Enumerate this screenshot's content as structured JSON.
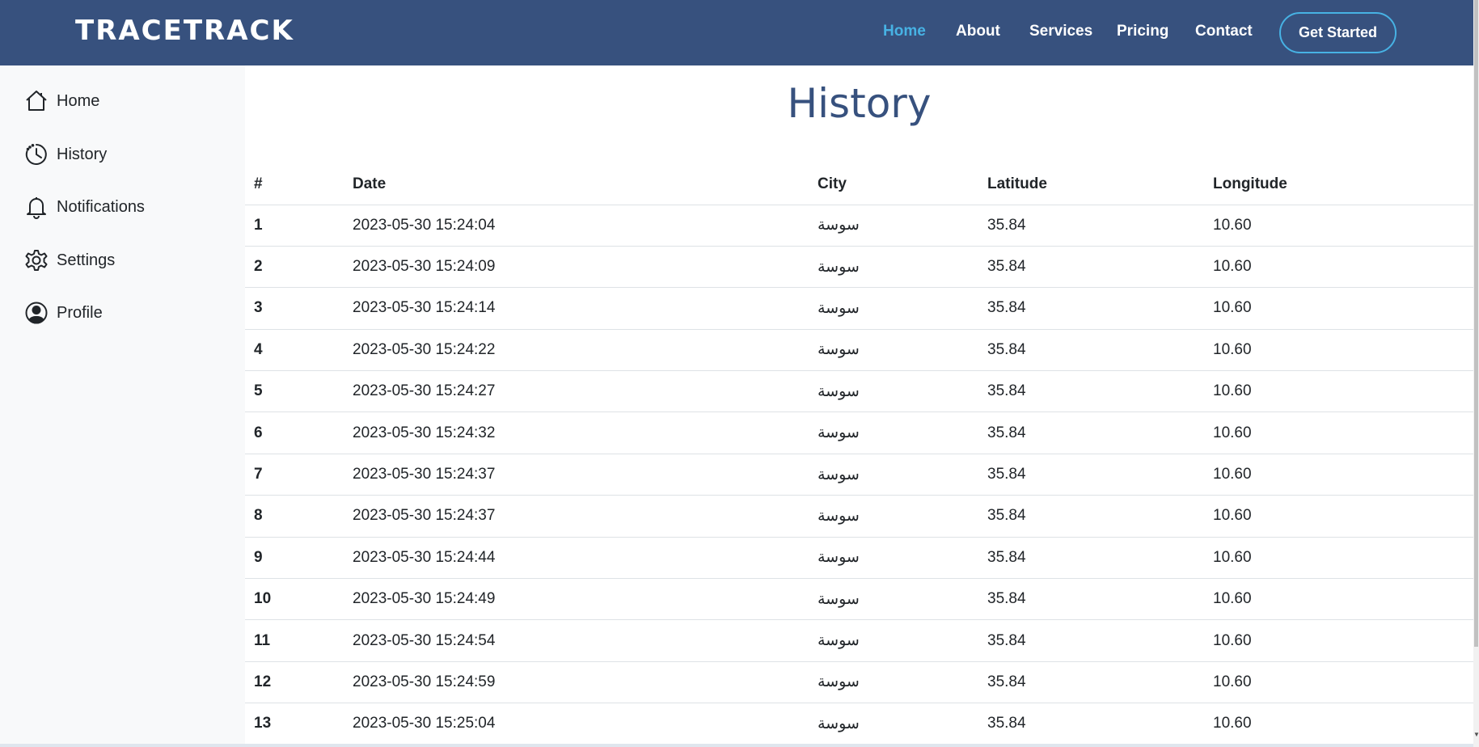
{
  "brand": {
    "logo": "TRACETRACK"
  },
  "nav": {
    "items": [
      "Home",
      "About",
      "Services",
      "Pricing",
      "Contact"
    ],
    "cta": "Get Started"
  },
  "sidebar": {
    "items": [
      {
        "label": "Home",
        "icon": "home-icon"
      },
      {
        "label": "History",
        "icon": "clock-icon"
      },
      {
        "label": "Notifications",
        "icon": "bell-icon"
      },
      {
        "label": "Settings",
        "icon": "gear-icon"
      },
      {
        "label": "Profile",
        "icon": "user-circle-icon"
      }
    ]
  },
  "page": {
    "title": "History"
  },
  "table": {
    "headers": [
      "#",
      "Date",
      "City",
      "Latitude",
      "Longitude"
    ],
    "rows": [
      [
        "1",
        "2023-05-30 15:24:04",
        "سوسة",
        "35.84",
        "10.60"
      ],
      [
        "2",
        "2023-05-30 15:24:09",
        "سوسة",
        "35.84",
        "10.60"
      ],
      [
        "3",
        "2023-05-30 15:24:14",
        "سوسة",
        "35.84",
        "10.60"
      ],
      [
        "4",
        "2023-05-30 15:24:22",
        "سوسة",
        "35.84",
        "10.60"
      ],
      [
        "5",
        "2023-05-30 15:24:27",
        "سوسة",
        "35.84",
        "10.60"
      ],
      [
        "6",
        "2023-05-30 15:24:32",
        "سوسة",
        "35.84",
        "10.60"
      ],
      [
        "7",
        "2023-05-30 15:24:37",
        "سوسة",
        "35.84",
        "10.60"
      ],
      [
        "8",
        "2023-05-30 15:24:37",
        "سوسة",
        "35.84",
        "10.60"
      ],
      [
        "9",
        "2023-05-30 15:24:44",
        "سوسة",
        "35.84",
        "10.60"
      ],
      [
        "10",
        "2023-05-30 15:24:49",
        "سوسة",
        "35.84",
        "10.60"
      ],
      [
        "11",
        "2023-05-30 15:24:54",
        "سوسة",
        "35.84",
        "10.60"
      ],
      [
        "12",
        "2023-05-30 15:24:59",
        "سوسة",
        "35.84",
        "10.60"
      ],
      [
        "13",
        "2023-05-30 15:25:04",
        "سوسة",
        "35.84",
        "10.60"
      ]
    ]
  },
  "colors": {
    "header_bg": "#37517e",
    "accent": "#47b2e4",
    "sidebar_bg": "#f8f9fa"
  }
}
